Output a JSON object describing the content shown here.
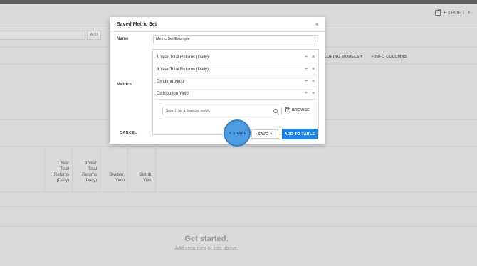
{
  "background": {
    "export_label": "EXPORT",
    "add_label": "ADD",
    "toolbar_items": [
      "CORING MODELS",
      "+  INFO COLUMNS"
    ],
    "columns": [
      {
        "lines": [
          "1 Year",
          "Total",
          "Returns",
          "(Daily)"
        ]
      },
      {
        "lines": [
          "3 Year",
          "Total",
          "Returns",
          "(Daily)"
        ]
      },
      {
        "lines": [
          "Dividen.",
          "Yield"
        ]
      },
      {
        "lines": [
          "Distrib.",
          "Yield"
        ]
      }
    ],
    "empty_title": "Get started.",
    "empty_sub": "Add securities or lists above."
  },
  "modal": {
    "title": "Saved Metric Set",
    "close_glyph": "×",
    "name_label": "Name",
    "name_value": "Metric Set Example",
    "metrics_label": "Metrics",
    "metrics": [
      {
        "label": "1 Year Total Returns (Daily)"
      },
      {
        "label": "3 Year Total Returns (Daily)"
      },
      {
        "label": "Dividend Yield"
      },
      {
        "label": "Distribution Yield"
      }
    ],
    "search_placeholder": "Search for a financial metric",
    "browse_label": "BROWSE",
    "cancel_label": "CANCEL",
    "share_label": "SHARE",
    "save_label": "SAVE",
    "add_to_table_label": "ADD TO TABLE",
    "accent_color": "#1b84e6"
  }
}
